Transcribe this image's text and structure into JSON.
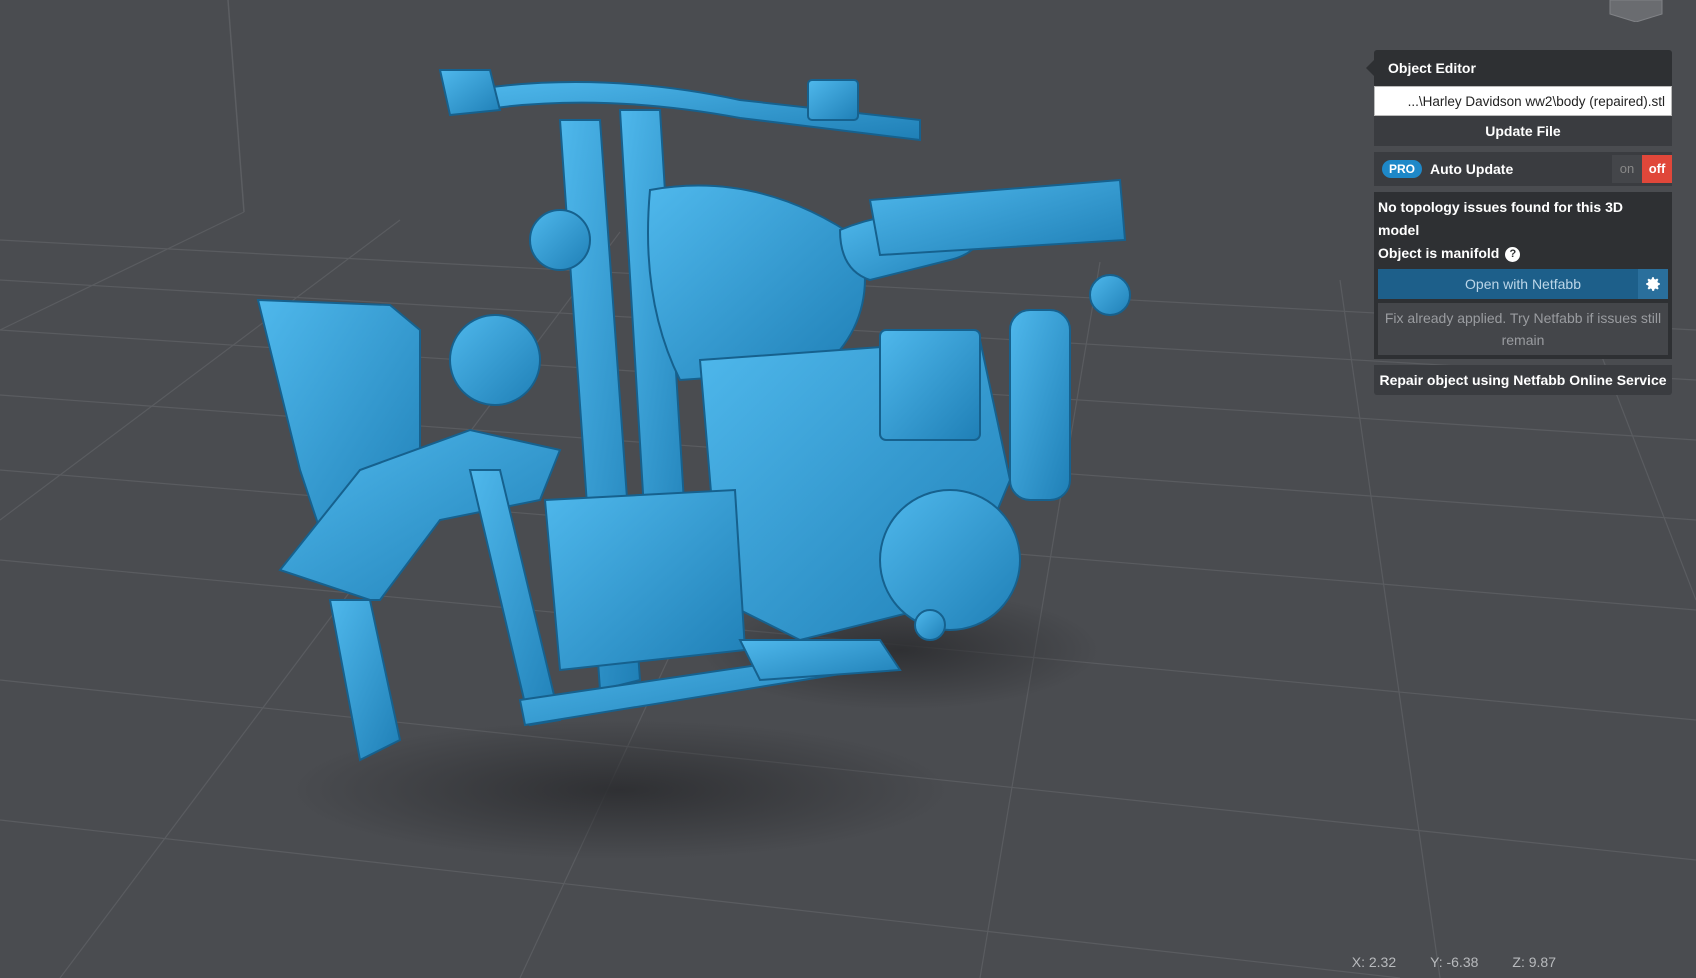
{
  "object_editor": {
    "title": "Object Editor",
    "file_path": "...\\Harley Davidson ww2\\body (repaired).stl",
    "update_file_label": "Update File",
    "pro_badge": "PRO",
    "auto_update_label": "Auto Update",
    "toggle_on_label": "on",
    "toggle_off_label": "off",
    "auto_update_state": "off",
    "topology_status": "No topology issues found for this 3D model",
    "manifold_status": "Object is manifold",
    "open_netfabb_label": "Open with Netfabb",
    "fix_note": "Fix already applied. Try Netfabb if issues still remain",
    "repair_label": "Repair object using Netfabb Online Service"
  },
  "coordinates": {
    "x": "X: 2.32",
    "y": "Y: -6.38",
    "z": "Z: 9.87"
  },
  "colors": {
    "background": "#4a4c50",
    "model": "#2f9bd6",
    "accent": "#1e88c8",
    "toggle_off": "#e0473a"
  },
  "icons": {
    "help": "question-circle-icon",
    "settings": "gear-icon"
  }
}
